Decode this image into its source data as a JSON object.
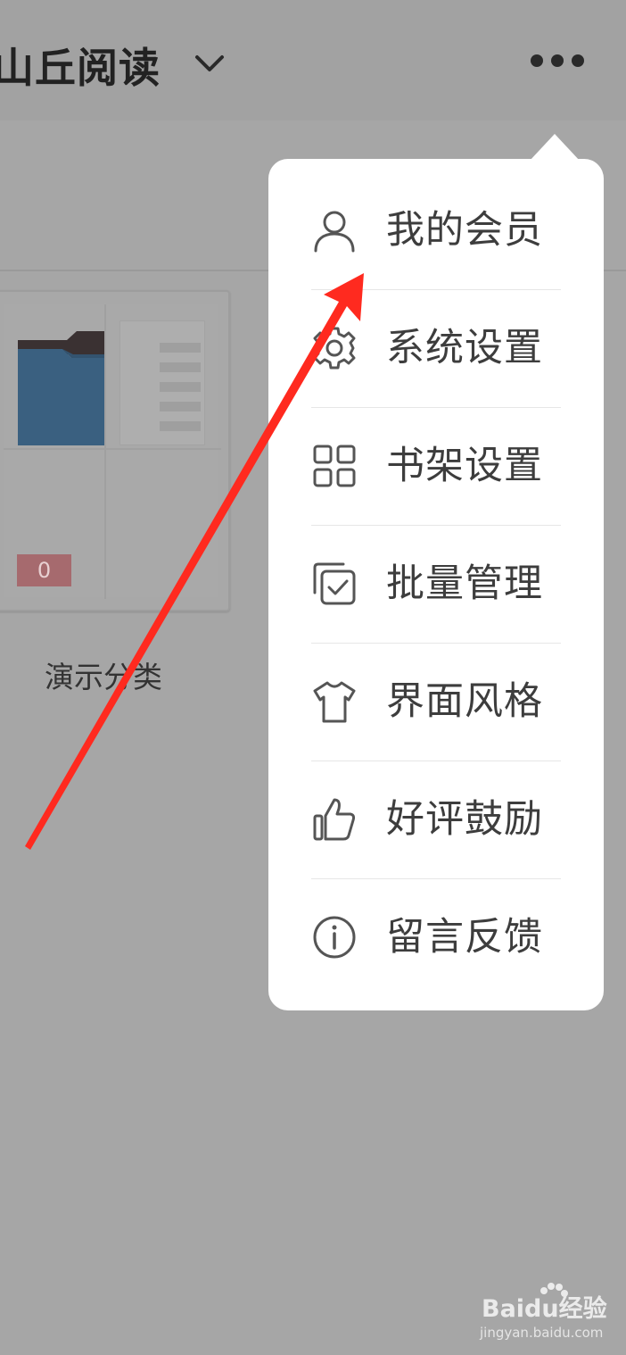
{
  "header": {
    "title": "山丘阅读",
    "dropdown_icon": "chevron-down-icon",
    "more_icon": "more-dots-icon"
  },
  "folder": {
    "name": "演示分类",
    "count": "0"
  },
  "menu": {
    "items": [
      {
        "label": "我的会员",
        "icon": "user-icon"
      },
      {
        "label": "系统设置",
        "icon": "gear-icon"
      },
      {
        "label": "书架设置",
        "icon": "grid-icon"
      },
      {
        "label": "批量管理",
        "icon": "multi-select-icon"
      },
      {
        "label": "界面风格",
        "icon": "tshirt-icon"
      },
      {
        "label": "好评鼓励",
        "icon": "thumbs-up-icon"
      },
      {
        "label": "留言反馈",
        "icon": "info-icon"
      }
    ]
  },
  "watermark": {
    "logo": "Baidu经验",
    "url": "jingyan.baidu.com"
  },
  "colors": {
    "overlay": "#a6a6a6",
    "popup": "#ffffff",
    "arrow": "#ff2a1f",
    "menu_text": "#3d3d3d"
  }
}
